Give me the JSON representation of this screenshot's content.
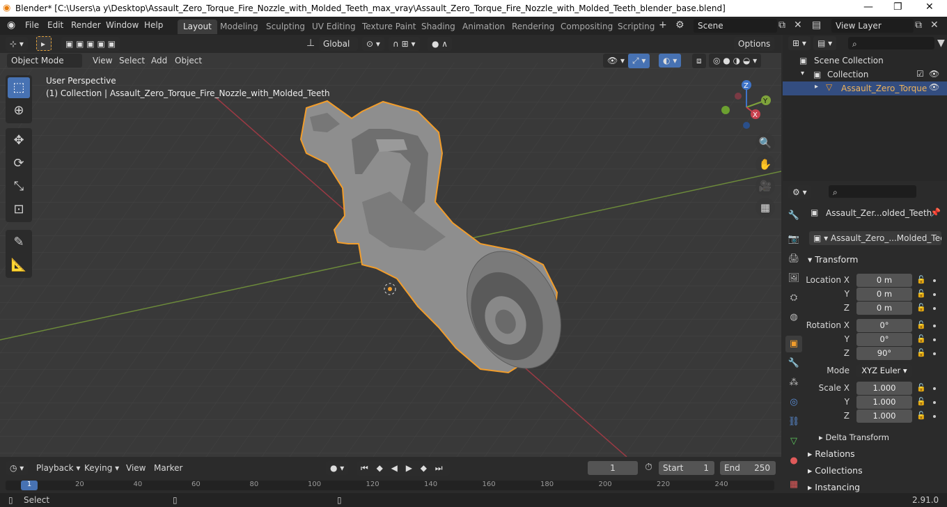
{
  "window": {
    "title": "Blender* [C:\\Users\\a y\\Desktop\\Assault_Zero_Torque_Fire_Nozzle_with_Molded_Teeth_max_vray\\Assault_Zero_Torque_Fire_Nozzle_with_Molded_Teeth_blender_base.blend]",
    "minimize": "—",
    "maximize": "❐",
    "close": "✕"
  },
  "menu": [
    "File",
    "Edit",
    "Render",
    "Window",
    "Help"
  ],
  "workspaces": [
    "Layout",
    "Modeling",
    "Sculpting",
    "UV Editing",
    "Texture Paint",
    "Shading",
    "Animation",
    "Rendering",
    "Compositing",
    "Scripting"
  ],
  "active_workspace": "Layout",
  "scene": {
    "label": "Scene",
    "view_layer": "View Layer"
  },
  "viewport": {
    "transform_orientation": "Global",
    "options_label": "Options",
    "mode": "Object Mode",
    "header_menu": [
      "View",
      "Select",
      "Add",
      "Object"
    ],
    "overlay_title": "User Perspective",
    "overlay_subtitle": "(1) Collection | Assault_Zero_Torque_Fire_Nozzle_with_Molded_Teeth",
    "gizmo": {
      "x": "X",
      "y": "Y",
      "z": "Z"
    }
  },
  "outliner": {
    "scene_collection": "Scene Collection",
    "collection": "Collection",
    "object": "Assault_Zero_Torque"
  },
  "properties": {
    "object_name": "Assault_Zer...olded_Teeth",
    "data_name": "Assault_Zero_...Molded_Teeth",
    "transform_label": "Transform",
    "location_label": "Location X",
    "rotation_label": "Rotation X",
    "scale_label": "Scale X",
    "y_label": "Y",
    "z_label": "Z",
    "location": [
      "0 m",
      "0 m",
      "0 m"
    ],
    "rotation": [
      "0°",
      "0°",
      "90°"
    ],
    "mode_label": "Mode",
    "mode_value": "XYZ Euler",
    "scale": [
      "1.000",
      "1.000",
      "1.000"
    ],
    "delta_transform": "Delta Transform",
    "relations": "Relations",
    "collections": "Collections",
    "instancing": "Instancing"
  },
  "timeline": {
    "menu": [
      "Playback",
      "Keying",
      "View",
      "Marker"
    ],
    "current_frame": "1",
    "start_label": "Start",
    "start": "1",
    "end_label": "End",
    "end": "250",
    "ruler": [
      "1",
      "20",
      "40",
      "60",
      "80",
      "100",
      "120",
      "140",
      "160",
      "180",
      "200",
      "220",
      "240"
    ]
  },
  "status": {
    "left": "Select",
    "version": "2.91.0"
  },
  "colors": {
    "accent": "#4772b3",
    "selection": "#f29d2b",
    "x_axis": "#c8414e",
    "y_axis": "#7ea33b",
    "z_axis": "#3f74c9"
  }
}
